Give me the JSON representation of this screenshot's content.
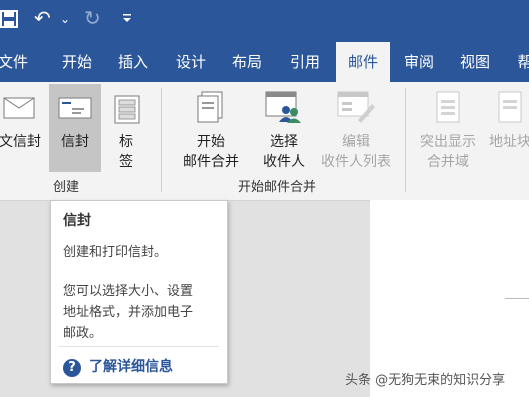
{
  "qat": {
    "save_icon": "save-icon",
    "undo": "↶",
    "undo_caret": "⌄",
    "redo": "↻",
    "customize": "₹"
  },
  "tabs": [
    "文件",
    "开始",
    "插入",
    "设计",
    "布局",
    "引用",
    "邮件",
    "审阅",
    "视图",
    "帮"
  ],
  "active_tab": "邮件",
  "ribbon": {
    "create_group": {
      "label": "创建",
      "buttons": [
        "文信封",
        "信封",
        "标",
        "签"
      ]
    },
    "mail_merge_group": {
      "label": "开始邮件合并",
      "start": {
        "line1": "开始",
        "line2": "邮件合并"
      },
      "select": {
        "line1": "选择",
        "line2": "收件人"
      },
      "edit": {
        "line1": "编辑",
        "line2": "收件人列表"
      }
    },
    "fields_group": {
      "highlight": {
        "line1": "突出显示",
        "line2": "合并域"
      },
      "address": {
        "line1": "地址块"
      }
    }
  },
  "tooltip": {
    "title": "信封",
    "line1": "创建和打印信封。",
    "body_l1": "您可以选择大小、设置",
    "body_l2": "地址格式，并添加电子",
    "body_l3": "邮政。",
    "help": "了解详细信息",
    "help_icon": "?"
  },
  "watermark": "头条 @无狗无束的知识分享",
  "colors": {
    "accent": "#2b579a",
    "ribbon_bg": "#f3f3f3"
  }
}
